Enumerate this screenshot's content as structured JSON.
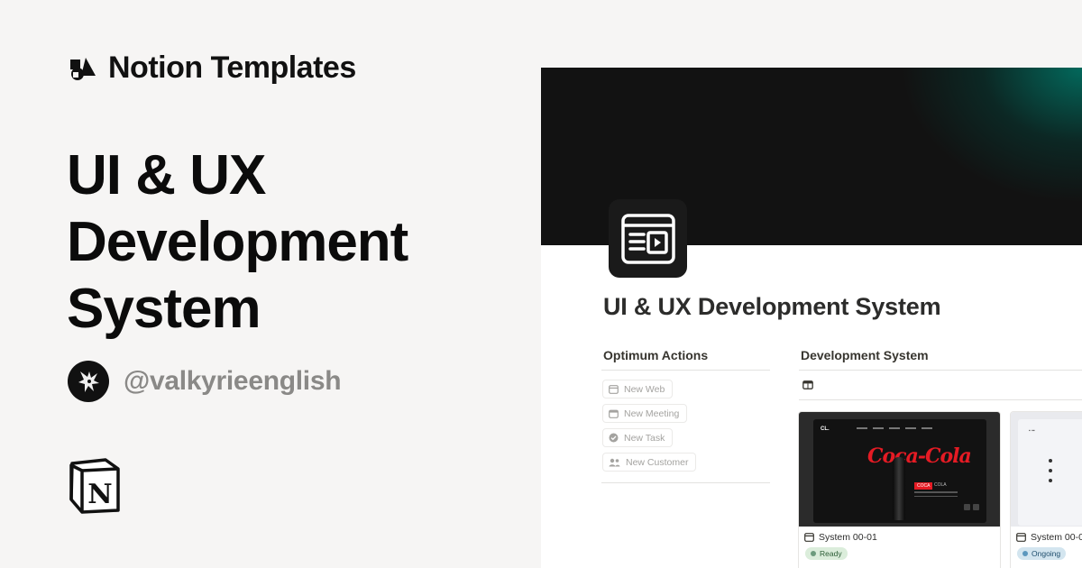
{
  "brand": {
    "label": "Notion Templates",
    "icon": "shapes-icon"
  },
  "hero": {
    "lines": [
      "UI & UX",
      "Development",
      "System"
    ]
  },
  "author": {
    "handle": "@valkyrieenglish",
    "avatar": "valkyrie-avatar"
  },
  "logo": {
    "name": "notion-logo",
    "letter": "N"
  },
  "mock": {
    "page_title": "UI & UX Development System",
    "page_icon": "video-window-icon",
    "left_column": {
      "heading": "Optimum Actions",
      "actions": [
        {
          "label": "New Web",
          "icon": "browser-icon"
        },
        {
          "label": "New Meeting",
          "icon": "calendar-icon"
        },
        {
          "label": "New Task",
          "icon": "check-circle-icon"
        },
        {
          "label": "New Customer",
          "icon": "people-icon"
        }
      ]
    },
    "right_column": {
      "heading": "Development System",
      "view_icon": "gallery-view-icon"
    },
    "cards": [
      {
        "title": "System 00-01",
        "status": "Ready",
        "preview": {
          "logo": "CL.",
          "script": "Coca-Cola",
          "badge": "COCA",
          "badge_text": "COLA"
        }
      },
      {
        "title": "System 00-0",
        "status": "Ongoing"
      }
    ]
  },
  "colors": {
    "background": "#f6f5f4",
    "cover": "#121212",
    "cover_glow": "#007869",
    "status_ready": "#dbeddb",
    "status_ongoing": "#d3e5ef",
    "muted_text": "#8a8987"
  }
}
